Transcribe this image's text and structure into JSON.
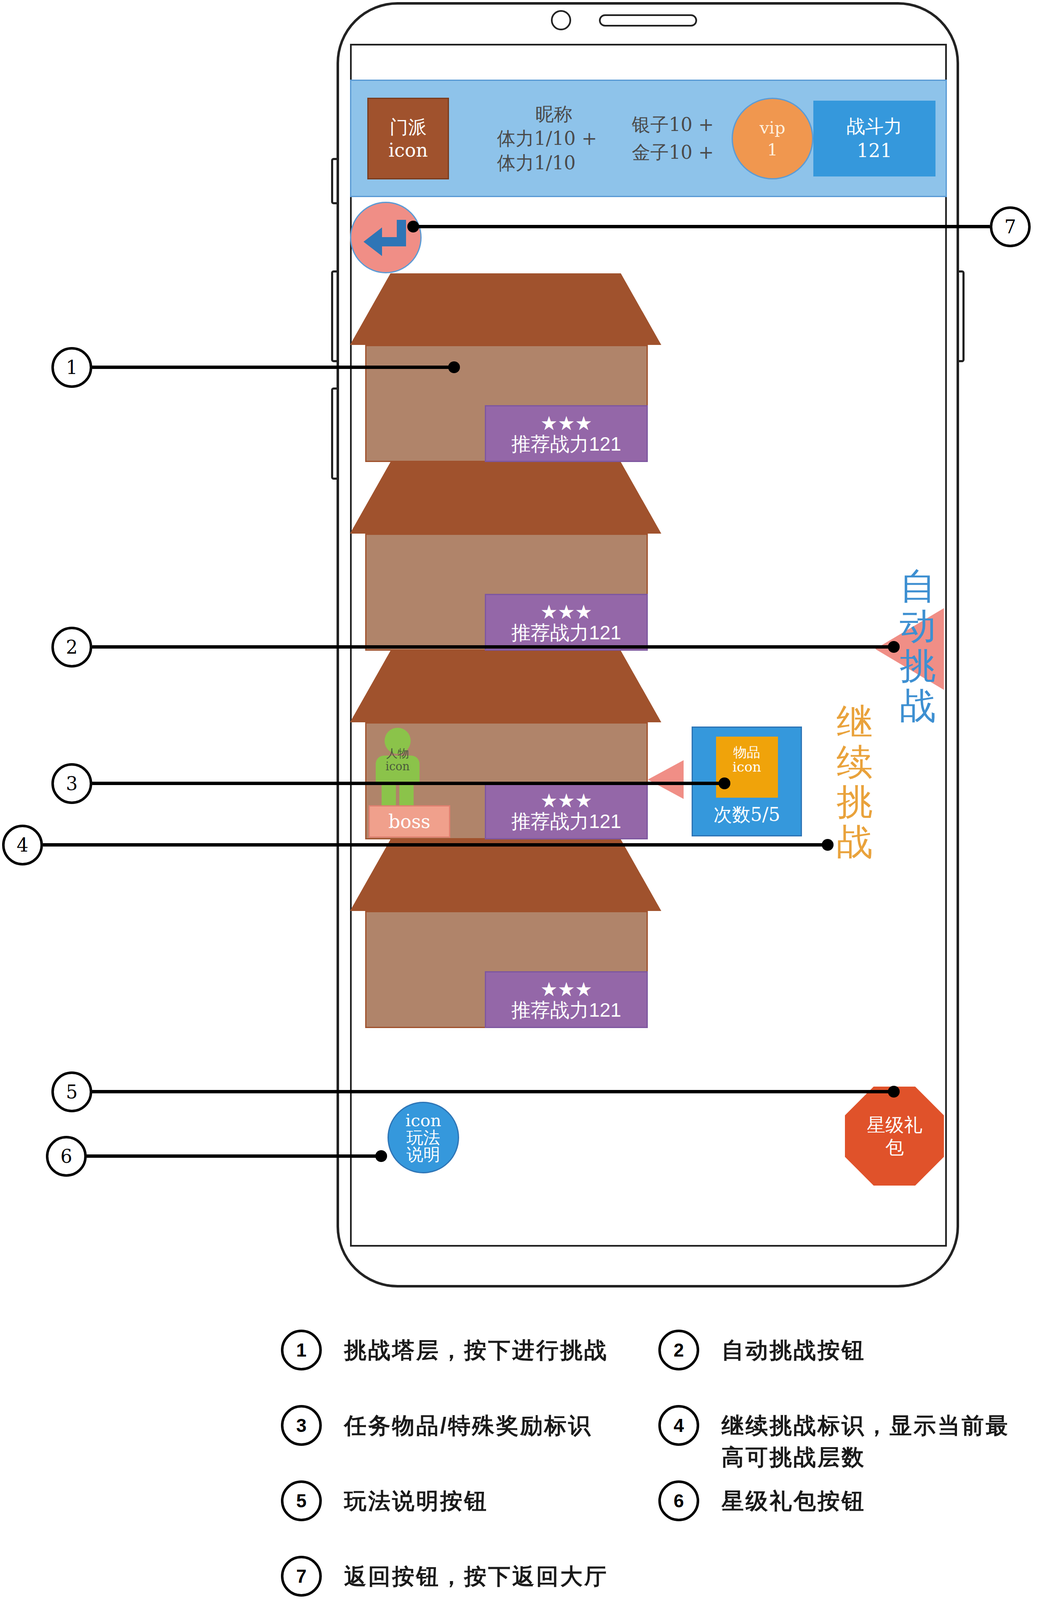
{
  "status_bar": {
    "sect_icon": "门派\nicon",
    "nickname": "昵称",
    "stamina": [
      "体力1/10 +",
      "体力1/10"
    ],
    "silver": "银子10 +",
    "gold": "金子10 +",
    "vip": "vip\n1",
    "combat_power": "战斗力\n121"
  },
  "floors": [
    {
      "stars": "★★★",
      "recommended_power": "推荐战力121",
      "current": false
    },
    {
      "stars": "★★★",
      "recommended_power": "推荐战力121",
      "current": false
    },
    {
      "stars": "★★★",
      "recommended_power": "推荐战力121",
      "current": true
    },
    {
      "stars": "★★★",
      "recommended_power": "推荐战力121",
      "current": false
    }
  ],
  "current_floor": {
    "character": "人物\nicon",
    "boss": "boss"
  },
  "reward": {
    "item": "物品\nicon",
    "count": "次数5/5"
  },
  "auto_challenge": "自动挑战",
  "continue_challenge": "继续挑战",
  "guide_button": "icon\n玩法\n说明",
  "star_gift_button": "星级礼包",
  "callouts": [
    "1",
    "2",
    "3",
    "4",
    "5",
    "6",
    "7"
  ],
  "legend": [
    {
      "number": "1",
      "text": "挑战塔层，按下进行挑战"
    },
    {
      "number": "2",
      "text": "自动挑战按钮"
    },
    {
      "number": "3",
      "text": "任务物品/特殊奖励标识"
    },
    {
      "number": "4",
      "text": "继续挑战标识，显示当前最高可挑战层数"
    },
    {
      "number": "5",
      "text": "玩法说明按钮"
    },
    {
      "number": "6",
      "text": "星级礼包按钮"
    },
    {
      "number": "7",
      "text": "返回按钮，按下返回大厅"
    }
  ]
}
